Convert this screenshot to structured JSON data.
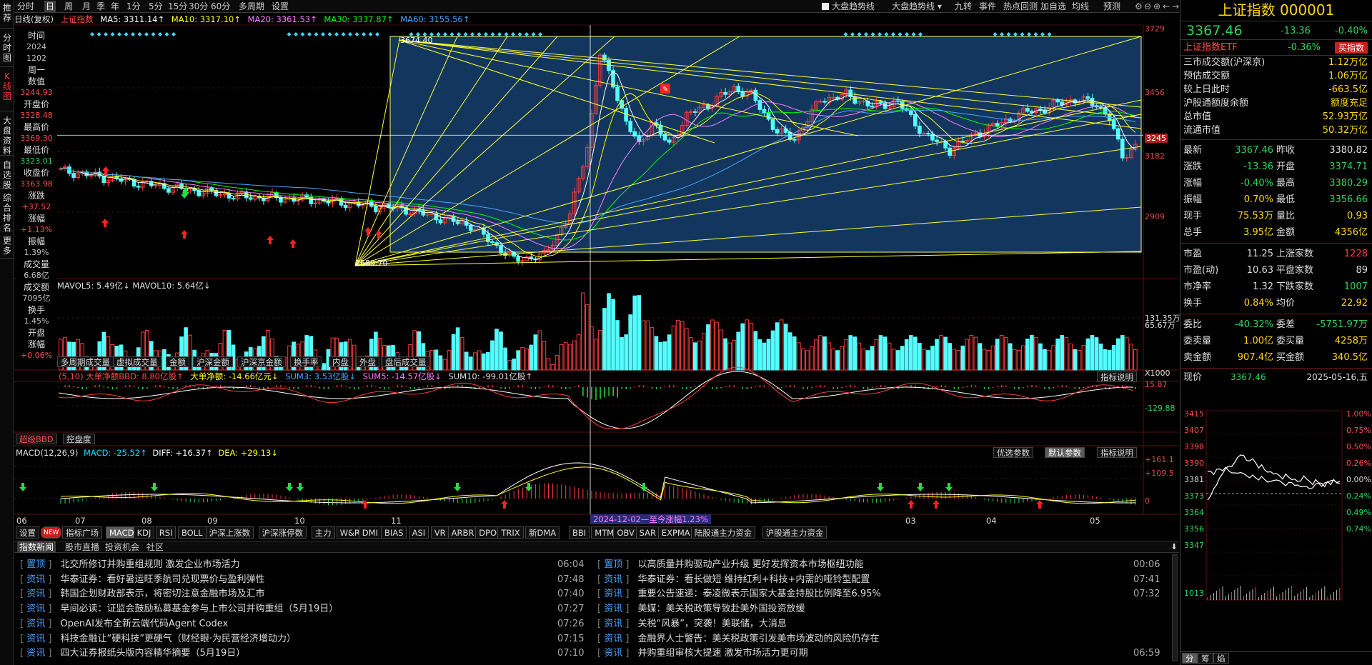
{
  "left_nav": [
    "推荐",
    "分时图",
    "K线图",
    "大盘资料",
    "自选股",
    "综合排名",
    "更多"
  ],
  "toolbar": {
    "periods": [
      "分时",
      "日",
      "周",
      "月",
      "季",
      "年",
      "1分",
      "5分",
      "15分",
      "30分",
      "60分",
      "多周期",
      "设置"
    ],
    "active_period": "日",
    "right_tools": [
      "大盘趋势线",
      "大盘趋势线 ▾",
      "九转",
      "事件",
      "热点回测",
      "加自选",
      "均线",
      "预测"
    ],
    "checkbox_label": "大盘趋势线"
  },
  "indicator_line": {
    "prefix": "日线(复权)",
    "name": "上证指数",
    "ma5": "MA5: 3311.14↑",
    "ma10": "MA10: 3317.10↑",
    "ma20": "MA20: 3361.53↑",
    "ma30": "MA30: 3337.87↑",
    "ma60": "MA60: 3155.56↑"
  },
  "colors": {
    "up": "#ff3b3b",
    "down": "#54ffff",
    "ma5": "#ffffff",
    "ma10": "#ffff00",
    "ma20": "#ff80ff",
    "ma30": "#00ff00",
    "ma60": "#4da6ff",
    "trend": "#ffff33",
    "box": "#15406f"
  },
  "datum": [
    {
      "k": "时间",
      "v": ""
    },
    {
      "k": "",
      "v": "2024"
    },
    {
      "k": "",
      "v": "1202"
    },
    {
      "k": "周一",
      "v": ""
    },
    {
      "k": "数值",
      "v": ""
    },
    {
      "k": "",
      "v": "3244.93",
      "cls": "red"
    },
    {
      "k": "开盘价",
      "v": ""
    },
    {
      "k": "",
      "v": "3328.48",
      "cls": "red"
    },
    {
      "k": "最高价",
      "v": ""
    },
    {
      "k": "",
      "v": "3369.30",
      "cls": "red"
    },
    {
      "k": "最低价",
      "v": ""
    },
    {
      "k": "",
      "v": "3323.01",
      "cls": "green"
    },
    {
      "k": "收盘价",
      "v": ""
    },
    {
      "k": "",
      "v": "3363.98",
      "cls": "red"
    },
    {
      "k": "涨跌",
      "v": ""
    },
    {
      "k": "",
      "v": "+37.52",
      "cls": "red"
    },
    {
      "k": "涨幅",
      "v": ""
    },
    {
      "k": "",
      "v": "+1.13%",
      "cls": "red"
    },
    {
      "k": "振幅",
      "v": ""
    },
    {
      "k": "",
      "v": "1.39%"
    },
    {
      "k": "成交量",
      "v": ""
    },
    {
      "k": "",
      "v": "6.68亿"
    },
    {
      "k": "成交额",
      "v": ""
    },
    {
      "k": "",
      "v": "7095亿"
    },
    {
      "k": "换手",
      "v": ""
    },
    {
      "k": "",
      "v": "1.45%"
    },
    {
      "k": "开盘",
      "v": ""
    },
    {
      "k": "涨幅",
      "v": ""
    },
    {
      "k": "",
      "v": "+0.06%",
      "cls": "red"
    }
  ],
  "price_axis": [
    "3729",
    "3456",
    "3245",
    "3182",
    "2909"
  ],
  "chart_labels": {
    "high": "3674.40",
    "low": "2689.70"
  },
  "volume": {
    "line": "MAVOL5: 5.49亿↓  MAVOL10: 5.64亿↓",
    "axis": [
      "131.35万",
      "65.67万",
      "X1000"
    ],
    "tabs": [
      "多周期成交量",
      "虚拟成交量",
      "金额",
      "沪深金额",
      "沪深京金额",
      "换手率",
      "内盘",
      "外盘",
      "盘后成交量"
    ]
  },
  "bbd": {
    "line1": "(5,10) 大单净额BBD: 8.80亿股↑",
    "line2": "大单净额: -14.66亿元↓",
    "line3": "SUM3: 3.53亿股↓",
    "line4": "SUM5: -14.57亿股↓",
    "line5": "SUM10: -99.01亿股↑",
    "btn": "指标说明",
    "axis": [
      "15.87",
      "-129.88"
    ],
    "tabs": [
      "超级BBD",
      "控盘度"
    ]
  },
  "macd": {
    "name": "MACD(12,26,9)",
    "macd": "MACD: -25.52↑",
    "diff": "DIFF: +16.37↑",
    "dea": "DEA: +29.13↓",
    "btns": [
      "优选参数",
      "默认参数",
      "指标说明"
    ],
    "axis": [
      "+161.1",
      "+109.5",
      "0"
    ]
  },
  "months": [
    "06",
    "07",
    "08",
    "09",
    "10",
    "11",
    "03",
    "04",
    "05"
  ],
  "crosshair_label": "2024-12-02—至今涨幅1.23%",
  "indicator_tabs": [
    "设置",
    "NEW",
    "指标广场",
    "MACD",
    "KDJ",
    "RSI",
    "BOLL",
    "沪深上涨数",
    "沪深涨停数",
    "主力",
    "W&R",
    "DMI",
    "BIAS",
    "ASI",
    "VR",
    "ARBR",
    "DPO",
    "TRIX",
    "新DMA",
    "BBI",
    "MTM",
    "OBV",
    "SAR",
    "EXPMA",
    "陆股通主力资金",
    "沪股通主力资金"
  ],
  "news_tabs": [
    "指数新闻",
    "股市直播",
    "投资机会",
    "社区"
  ],
  "news_left": [
    {
      "tag": "置顶",
      "text": "北交所修订并购重组规则 激发企业市场活力",
      "time": "06:04"
    },
    {
      "tag": "资讯",
      "text": "华泰证券：看好暑运旺季航司兑现票价与盈利弹性",
      "time": "07:48"
    },
    {
      "tag": "资讯",
      "text": "韩国企划财政部表示，将密切注意金融市场及汇市",
      "time": "07:40"
    },
    {
      "tag": "资讯",
      "text": "早间必读：证监会鼓励私募基金参与上市公司并购重组（5月19日）",
      "time": "07:27"
    },
    {
      "tag": "资讯",
      "text": "OpenAI发布全新云端代码Agent Codex",
      "time": "07:26"
    },
    {
      "tag": "资讯",
      "text": "科技金融让“硬科技”更硬气（财经眼·为民营经济增动力）",
      "time": "07:15"
    },
    {
      "tag": "资讯",
      "text": "四大证券报纸头版内容精华摘要（5月19日）",
      "time": "07:10"
    }
  ],
  "news_right": [
    {
      "tag": "置顶",
      "text": "以高质量并购驱动产业升级 更好发挥资本市场枢纽功能",
      "time": "00:06"
    },
    {
      "tag": "资讯",
      "text": "华泰证券：看长做短 维持红利+科技+内需的哑铃型配置",
      "time": "07:41"
    },
    {
      "tag": "资讯",
      "text": "重要公告速递：泰凌微表示国家大基金持股比例降至6.95%",
      "time": "07:32"
    },
    {
      "tag": "资讯",
      "text": "美媒：美关税政策导致赴美外国投资放缓",
      "time": ""
    },
    {
      "tag": "资讯",
      "text": "关税“风暴”，突袭！美联储，大消息",
      "time": ""
    },
    {
      "tag": "资讯",
      "text": "金融界人士警告：美关税政策引发美市场波动的风险仍存在",
      "time": ""
    },
    {
      "tag": "资讯",
      "text": "并购重组审核大提速 激发市场活力更可期",
      "time": "06:59"
    }
  ],
  "right": {
    "title": "上证指数 000001",
    "price": "3367.46",
    "change": "-13.36",
    "pct": "-0.40%",
    "etf_name": "上证指数ETF",
    "etf_pct": "-0.36%",
    "etf_btn": "买指数",
    "stats": [
      {
        "k": "三市成交额(沪深京)",
        "v": "1.12万亿",
        "c": "#ffd700"
      },
      {
        "k": "预估成交额",
        "v": "1.06万亿",
        "c": "#ffd700"
      },
      {
        "k": "较上日此时",
        "v": "-663.5亿",
        "c": "#ffd700"
      },
      {
        "k": "沪股通额度余额",
        "v": "额度充足",
        "c": "#ffd700"
      },
      {
        "k": "总市值",
        "v": "52.93万亿",
        "c": "#ffd700"
      },
      {
        "k": "流通市值",
        "v": "50.32万亿",
        "c": "#ffd700"
      }
    ],
    "quad": [
      [
        "最新",
        "3367.46",
        "昨收",
        "3380.82",
        "#2bd65a",
        "#ddd"
      ],
      [
        "涨跌",
        "-13.36",
        "开盘",
        "3374.71",
        "#2bd65a",
        "#2bd65a"
      ],
      [
        "涨幅",
        "-0.40%",
        "最高",
        "3380.29",
        "#2bd65a",
        "#2bd65a"
      ],
      [
        "振幅",
        "0.70%",
        "最低",
        "3356.66",
        "#ffd700",
        "#2bd65a"
      ],
      [
        "现手",
        "75.53万",
        "量比",
        "0.93",
        "#ffd700",
        "#ffd700"
      ],
      [
        "总手",
        "3.95亿",
        "金额",
        "4356亿",
        "#ffd700",
        "#ffd700"
      ]
    ],
    "quad2": [
      [
        "市盈",
        "11.25",
        "上涨家数",
        "1228",
        "#ddd",
        "#ff3b3b"
      ],
      [
        "市盈(动)",
        "10.63",
        "平盘家数",
        "89",
        "#ddd",
        "#ddd"
      ],
      [
        "市净率",
        "1.32",
        "下跌家数",
        "1007",
        "#ddd",
        "#2bd65a"
      ],
      [
        "换手",
        "0.84%",
        "均价",
        "22.92",
        "#ffd700",
        "#ffd700"
      ]
    ],
    "quad3": [
      [
        "委比",
        "-40.32%",
        "委差",
        "-5751.97万",
        "#2bd65a",
        "#2bd65a"
      ],
      [
        "委卖量",
        "1.00亿",
        "委买量",
        "4258万",
        "#ffd700",
        "#ffd700"
      ],
      [
        "卖金额",
        "907.4亿",
        "买金额",
        "340.5亿",
        "#ffd700",
        "#ffd700"
      ]
    ],
    "now_label": "现价",
    "now_price": "3367.46",
    "now_date": "2025-05-16,五",
    "mini_left": [
      "3415",
      "3407",
      "3398",
      "3390",
      "3381",
      "3373",
      "3364",
      "3356",
      "3347",
      "1013"
    ],
    "mini_right": [
      "1.00%",
      "0.75%",
      "0.50%",
      "0.26%",
      "0.00%",
      "0.24%",
      "0.49%",
      "0.74%"
    ],
    "bottom_tabs": [
      "分",
      "筹",
      "焰"
    ]
  }
}
